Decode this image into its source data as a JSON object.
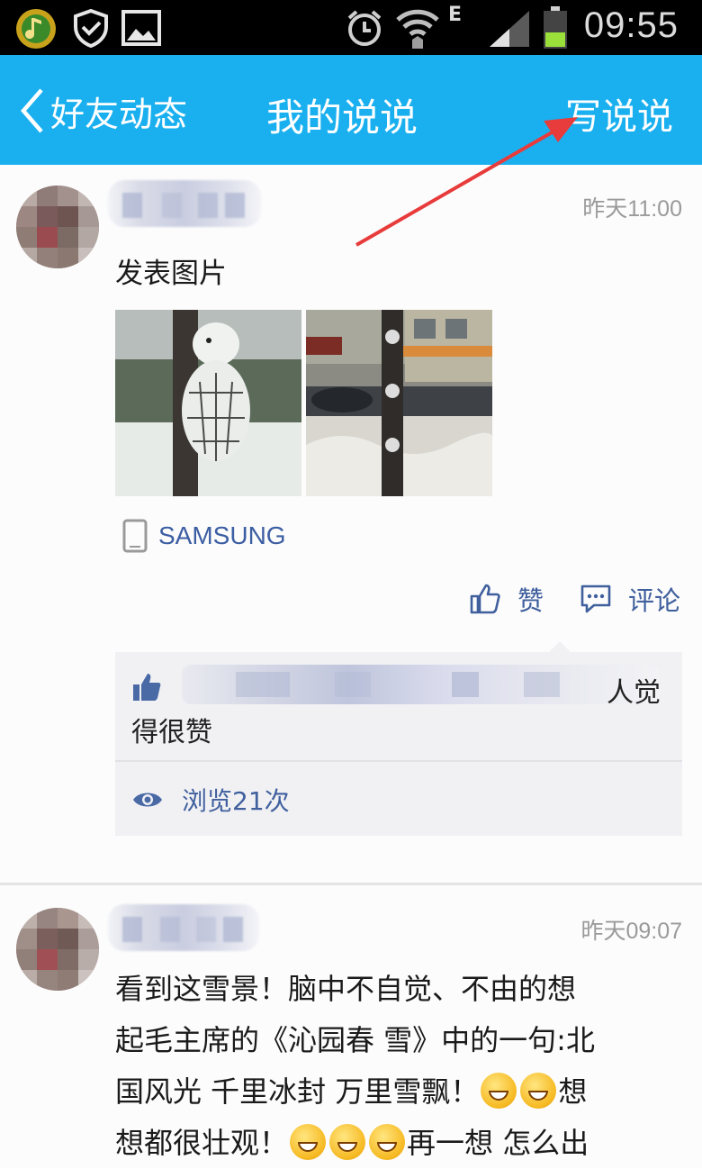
{
  "status_bar": {
    "time": "09:55",
    "network_type": "E",
    "icons": [
      "music-app-icon",
      "security-app-icon",
      "gallery-icon",
      "alarm-icon",
      "wifi-icon",
      "signal-icon",
      "battery-icon"
    ]
  },
  "nav": {
    "back_label": "好友动态",
    "title": "我的说说",
    "action_label": "写说说",
    "bg_color": "#1ab0ef"
  },
  "posts": [
    {
      "time": "昨天11:00",
      "text": "发表图片",
      "device": "SAMSUNG",
      "actions": {
        "like_label": "赞",
        "comment_label": "评论"
      },
      "likes": {
        "tail_text": "人觉",
        "line2": "得很赞"
      },
      "views": "浏览21次"
    },
    {
      "time": "昨天09:07",
      "text_line1": "看到这雪景！脑中不自觉、不由的想",
      "text_line2": "起毛主席的《沁园春 雪》中的一句:北",
      "text_line3_a": "国风光 千里冰封 万里雪飘！",
      "text_line3_b": "想",
      "text_line4_a": "想都很壮观！",
      "text_line4_b": "再一想 怎么出"
    }
  ],
  "colors": {
    "accent": "#1ab0ef",
    "link": "#3f5f9d",
    "annotation_arrow": "#e83b3b"
  }
}
